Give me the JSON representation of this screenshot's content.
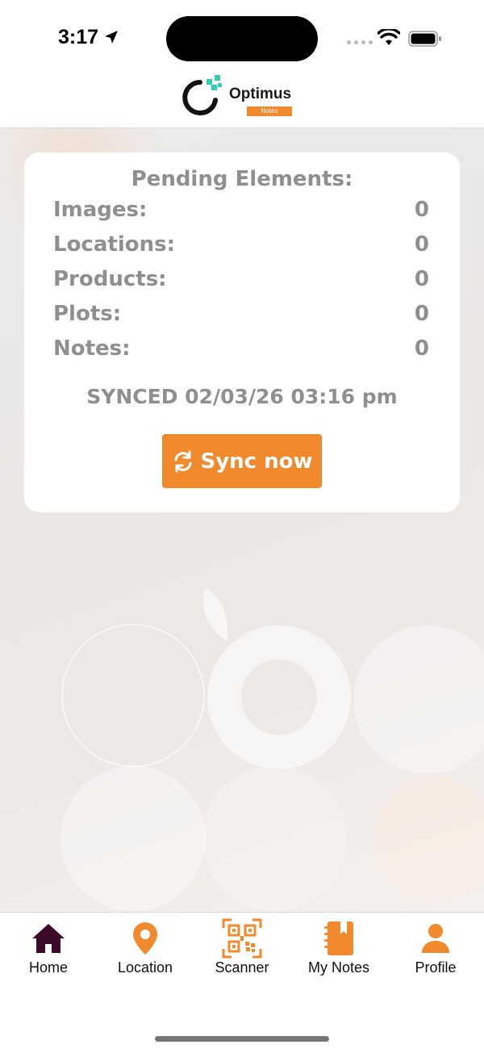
{
  "status_bar": {
    "time": "3:17"
  },
  "header": {
    "logo_text": "Optimus",
    "logo_sub": "Notes"
  },
  "card": {
    "title": "Pending Elements:",
    "rows": [
      {
        "label": "Images:",
        "value": "0"
      },
      {
        "label": "Locations:",
        "value": "0"
      },
      {
        "label": "Products:",
        "value": "0"
      },
      {
        "label": "Plots:",
        "value": "0"
      },
      {
        "label": "Notes:",
        "value": "0"
      }
    ],
    "synced": "SYNCED 02/03/26 03:16 pm",
    "sync_button": "Sync now"
  },
  "tabs": [
    {
      "label": "Home",
      "icon": "home-icon",
      "active": true
    },
    {
      "label": "Location",
      "icon": "location-pin-icon"
    },
    {
      "label": "Scanner",
      "icon": "qr-code-icon"
    },
    {
      "label": "My Notes",
      "icon": "notebook-icon"
    },
    {
      "label": "Profile",
      "icon": "user-icon"
    }
  ],
  "colors": {
    "accent": "#f08a2c",
    "active_tab": "#3d0b2a",
    "muted_text": "#8f8f8f"
  }
}
